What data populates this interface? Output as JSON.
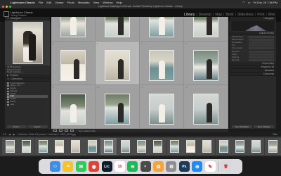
{
  "menubar": {
    "app_name": "Lightroom Classic",
    "items": [
      "File",
      "Edit",
      "Library",
      "Photo",
      "Metadata",
      "View",
      "Window",
      "Help"
    ],
    "datetime": "Fri Dec 28 7:38 PM"
  },
  "window": {
    "title": "Lightroom Catalog-2-v13.lrcat - Adobe Photoshop Lightroom Classic - Library"
  },
  "idplate": {
    "app_name": "Lightroom Classic",
    "user_name": "Jenny Roberts"
  },
  "modules": [
    "Library",
    "Develop",
    "Map",
    "Book",
    "Slideshow",
    "Print",
    "Web"
  ],
  "active_module": "Library",
  "left_panel": {
    "navigator_label": "Navigator",
    "catalog_rows": [
      {
        "label": "All Photographs",
        "count": ""
      },
      {
        "label": "Previous Import",
        "count": ""
      },
      {
        "label": "Quick Collection +",
        "count": ""
      }
    ],
    "folders_label": "Folders",
    "collections_label": "Collections",
    "collection_rows": [
      {
        "label": "Smart Collections",
        "count": "",
        "selected": false
      },
      {
        "label": "Jenny + Tom",
        "count": "",
        "selected": false
      },
      {
        "label": "Selects",
        "count": "",
        "selected": false
      },
      {
        "label": "Portraits",
        "count": "",
        "selected": false
      },
      {
        "label": "Details",
        "count": "",
        "selected": false
      },
      {
        "label": "Edits",
        "count": "",
        "selected": true
      },
      {
        "label": "Couple",
        "count": "",
        "selected": false
      },
      {
        "label": "Family",
        "count": "",
        "selected": false
      },
      {
        "label": "Lake",
        "count": "",
        "selected": false
      }
    ],
    "import_button": "Import...",
    "export_button": "Export..."
  },
  "grid": {
    "cells": [
      {
        "num": "1",
        "photo": "p2",
        "person": "light"
      },
      {
        "num": "2",
        "photo": "p5",
        "person": "dark"
      },
      {
        "num": "3",
        "photo": "p4",
        "person": "light"
      },
      {
        "num": "4",
        "photo": "p5",
        "person": "dark"
      },
      {
        "num": "5",
        "photo": "p1",
        "person": "dark"
      },
      {
        "num": "6",
        "photo": "p7",
        "person": "dark"
      },
      {
        "num": "7",
        "photo": "p3",
        "person": "light"
      },
      {
        "num": "8",
        "photo": "p6",
        "person": "dark"
      },
      {
        "num": "9",
        "photo": "p5",
        "person": "light"
      },
      {
        "num": "10",
        "photo": "p4",
        "person": "dark"
      },
      {
        "num": "11",
        "photo": "p8",
        "person": "light"
      },
      {
        "num": "12",
        "photo": "p8",
        "person": "dark"
      },
      {
        "num": "13",
        "photo": "p7",
        "person": "light"
      },
      {
        "num": "14",
        "photo": "p3",
        "person": "dark"
      },
      {
        "num": "15",
        "photo": "p6",
        "person": "light"
      },
      {
        "num": "16",
        "photo": "p2",
        "person": "dark"
      }
    ],
    "selected_index": 5
  },
  "right_panel": {
    "sections": [
      "Histogram",
      "Quick Develop",
      "Keywording",
      "Keyword List",
      "Metadata",
      "Comments"
    ],
    "rows": [
      "Saved Preset",
      "White Balance",
      "Temperature",
      "Tint",
      "Tone Control",
      "Exposure",
      "Clarity",
      "Vibrance",
      "Reset All"
    ],
    "sync_button": "Sync Metadata",
    "sync_settings_button": "Sync Settings"
  },
  "toolbar": {
    "sort_label": "Sort: Added Order"
  },
  "filmstrip_bar": {
    "page_nums": "1 2",
    "path": "Collection: Edits  101 photos / 1 selected / 1 IMG_9234.jpg",
    "filter": "Filter:"
  },
  "filmstrip": {
    "count": 17,
    "selected_index": 6
  },
  "dock": {
    "icons": [
      {
        "name": "finder-icon",
        "color": "#3b8fe6",
        "glyph": "☺"
      },
      {
        "name": "notes-icon",
        "color": "#f4c430",
        "glyph": "≡"
      },
      {
        "name": "messages-icon",
        "color": "#34c759",
        "glyph": "✉"
      },
      {
        "name": "chrome-icon",
        "color": "#db4437",
        "glyph": "◉"
      },
      {
        "name": "lightroom-icon",
        "color": "#0d1b2a",
        "glyph": "Lrc"
      },
      {
        "name": "calendar-icon",
        "color": "#ffffff",
        "glyph": "16"
      },
      {
        "name": "spotify-icon",
        "color": "#1db954",
        "glyph": "≋"
      },
      {
        "name": "davinci-icon",
        "color": "#4a4a4a",
        "glyph": "◐"
      },
      {
        "name": "photos-icon",
        "color": "#f7a23b",
        "glyph": "✿"
      },
      {
        "name": "system-settings-icon",
        "color": "#8e8e93",
        "glyph": "⚙"
      },
      {
        "name": "photoshop-icon",
        "color": "#1c3a5a",
        "glyph": "Ps"
      },
      {
        "name": "safari-icon",
        "color": "#1a8cff",
        "glyph": "⊕"
      },
      {
        "name": "illustration-app-icon",
        "color": "#ffffff",
        "glyph": "✎"
      },
      {
        "name": "trash-icon",
        "color": "#d8d8dc",
        "glyph": "🗑"
      }
    ]
  }
}
